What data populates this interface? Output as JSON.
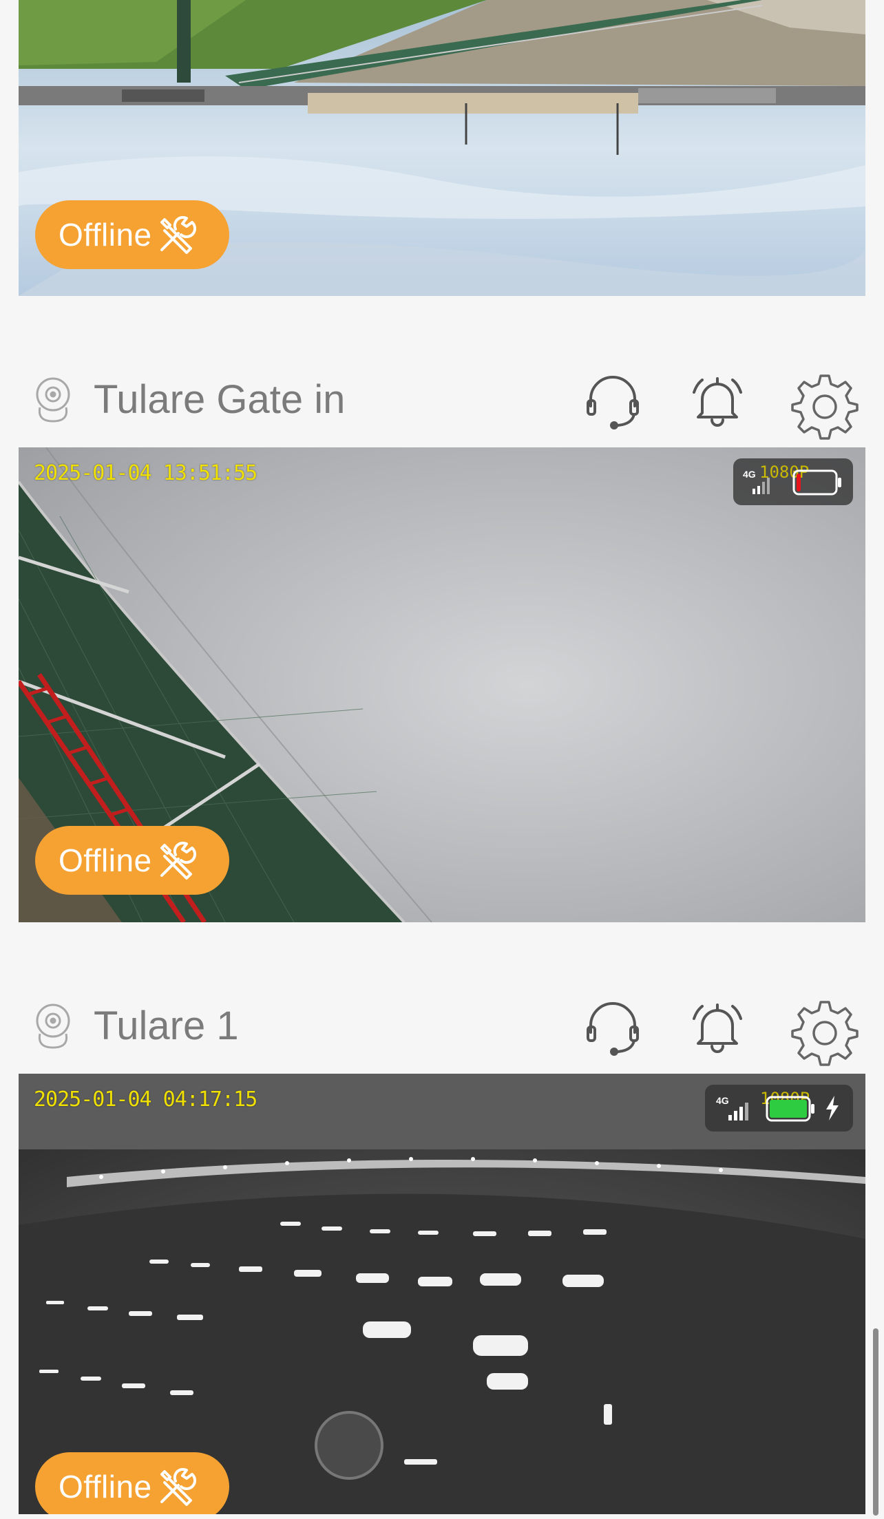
{
  "feeds": [
    {
      "status_label": "Offline"
    },
    {
      "camera_name": "Tulare Gate in",
      "timestamp": "2025-01-04 13:51:55",
      "network": "4G",
      "resolution": "1080P",
      "battery_level": 0.05,
      "battery_color": "#e8141b",
      "charging": false,
      "status_label": "Offline"
    },
    {
      "camera_name": "Tulare 1",
      "timestamp": "2025-01-04 04:17:15",
      "network": "4G",
      "resolution": "1080P",
      "battery_level": 1.0,
      "battery_color": "#2ecc40",
      "charging": true,
      "status_label": "Offline"
    }
  ],
  "icons": {
    "camera": "camera-icon",
    "support": "headset-icon",
    "alerts": "bell-icon",
    "settings": "gear-icon",
    "tools": "wrench-screwdriver-icon",
    "charging": "lightning-icon"
  },
  "colors": {
    "offline_badge": "#f5a233",
    "timestamp": "#f0e000",
    "camera_name": "#7b7b7b"
  }
}
